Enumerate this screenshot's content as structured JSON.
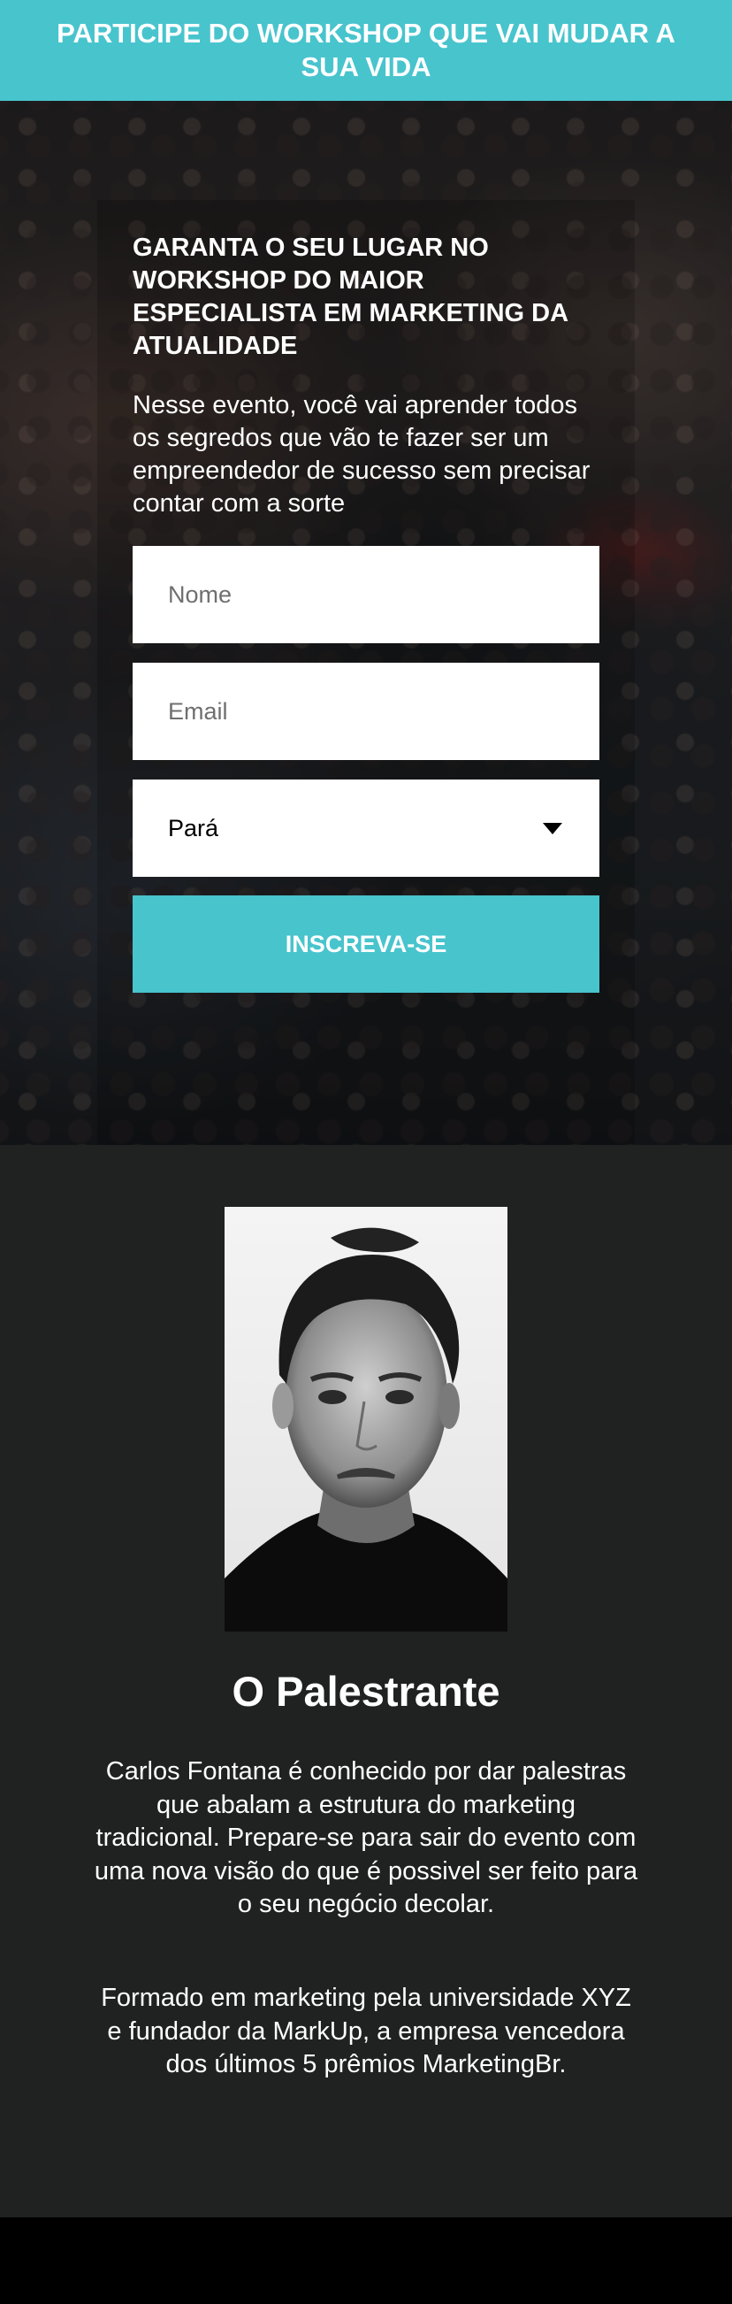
{
  "topbar": {
    "text": "PARTICIPE DO WORKSHOP QUE VAI MUDAR A SUA VIDA"
  },
  "hero": {
    "title": "GARANTA O SEU LUGAR NO WORKSHOP DO MAIOR ESPECIALISTA EM MARKETING DA ATUALIDADE",
    "description": "Nesse evento, você vai aprender todos os segredos que vão te fazer ser um empreendedor de sucesso sem precisar contar com a sorte",
    "form": {
      "name_placeholder": "Nome",
      "email_placeholder": "Email",
      "state_selected": "Pará",
      "submit_label": "INSCREVA-SE"
    }
  },
  "speaker": {
    "heading": "O Palestrante",
    "bio_1": "Carlos Fontana é conhecido por dar palestras que abalam a estrutura do marketing tradicional. Prepare-se para sair do evento com uma nova visão do que é possivel ser feito para o seu negócio decolar.",
    "bio_2": "Formado em marketing pela universidade XYZ e fundador da MarkUp, a empresa vencedora dos últimos 5 prêmios MarketingBr."
  },
  "colors": {
    "accent": "#48c4cd",
    "speaker_bg": "#202121",
    "footer_bg": "#000000"
  }
}
